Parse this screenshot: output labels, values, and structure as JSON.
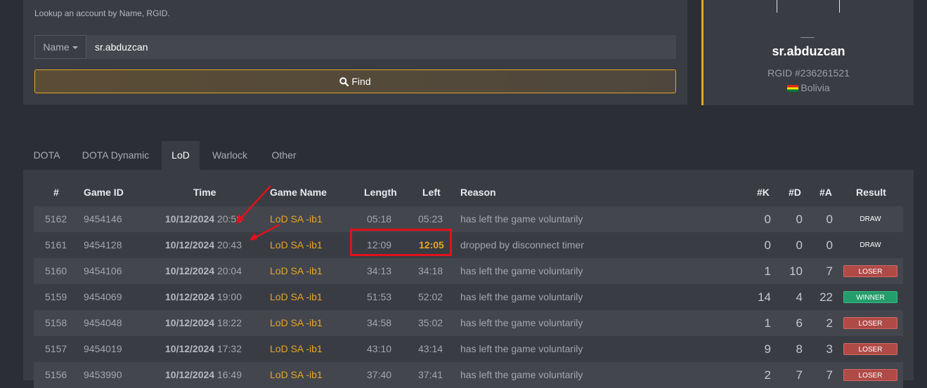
{
  "search": {
    "hint": "Lookup an account by Name, RGID.",
    "field_type": "Name",
    "query": "sr.abduzcan",
    "find_label": "Find"
  },
  "profile": {
    "name": "sr.abduzcan",
    "rgid": "RGID #236261521",
    "country": "Bolivia"
  },
  "tabs": [
    {
      "label": "DOTA",
      "active": false
    },
    {
      "label": "DOTA Dynamic",
      "active": false
    },
    {
      "label": "LoD",
      "active": true
    },
    {
      "label": "Warlock",
      "active": false
    },
    {
      "label": "Other",
      "active": false
    }
  ],
  "table": {
    "headers": {
      "num": "#",
      "game_id": "Game ID",
      "time": "Time",
      "game_name": "Game Name",
      "length": "Length",
      "left": "Left",
      "reason": "Reason",
      "k": "#K",
      "d": "#D",
      "a": "#A",
      "result": "Result"
    },
    "rows": [
      {
        "num": "5162",
        "game_id": "9454146",
        "date": "10/12/2024",
        "clock": "20:58",
        "game_name": "LoD SA -ib1",
        "length": "05:18",
        "left": "05:23",
        "reason": "has left the game voluntarily",
        "k": "0",
        "d": "0",
        "a": "0",
        "result": "DRAW",
        "result_type": "draw"
      },
      {
        "num": "5161",
        "game_id": "9454128",
        "date": "10/12/2024",
        "clock": "20:43",
        "game_name": "LoD SA -ib1",
        "length": "12:09",
        "left": "12:05",
        "reason": "dropped by disconnect timer",
        "k": "0",
        "d": "0",
        "a": "0",
        "result": "DRAW",
        "result_type": "draw"
      },
      {
        "num": "5160",
        "game_id": "9454106",
        "date": "10/12/2024",
        "clock": "20:04",
        "game_name": "LoD SA -ib1",
        "length": "34:13",
        "left": "34:18",
        "reason": "has left the game voluntarily",
        "k": "1",
        "d": "10",
        "a": "7",
        "result": "LOSER",
        "result_type": "loser"
      },
      {
        "num": "5159",
        "game_id": "9454069",
        "date": "10/12/2024",
        "clock": "19:00",
        "game_name": "LoD SA -ib1",
        "length": "51:53",
        "left": "52:02",
        "reason": "has left the game voluntarily",
        "k": "14",
        "d": "4",
        "a": "22",
        "result": "WINNER",
        "result_type": "winner"
      },
      {
        "num": "5158",
        "game_id": "9454048",
        "date": "10/12/2024",
        "clock": "18:22",
        "game_name": "LoD SA -ib1",
        "length": "34:58",
        "left": "35:02",
        "reason": "has left the game voluntarily",
        "k": "1",
        "d": "6",
        "a": "2",
        "result": "LOSER",
        "result_type": "loser"
      },
      {
        "num": "5157",
        "game_id": "9454019",
        "date": "10/12/2024",
        "clock": "17:32",
        "game_name": "LoD SA -ib1",
        "length": "43:10",
        "left": "43:14",
        "reason": "has left the game voluntarily",
        "k": "9",
        "d": "8",
        "a": "3",
        "result": "LOSER",
        "result_type": "loser"
      },
      {
        "num": "5156",
        "game_id": "9453990",
        "date": "10/12/2024",
        "clock": "16:49",
        "game_name": "LoD SA -ib1",
        "length": "37:40",
        "left": "37:41",
        "reason": "has left the game voluntarily",
        "k": "2",
        "d": "7",
        "a": "7",
        "result": "LOSER",
        "result_type": "loser"
      }
    ]
  },
  "colors": {
    "accent": "#e0a526",
    "annotation": "#e0121b",
    "loser": "#b04a47",
    "winner": "#239d6b"
  }
}
